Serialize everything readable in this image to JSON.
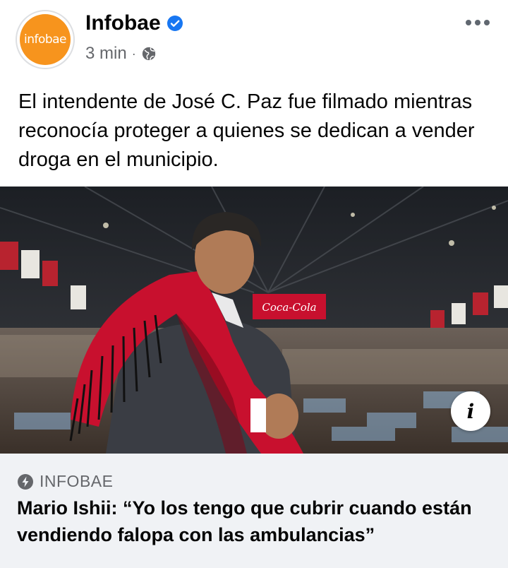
{
  "post": {
    "page_name": "Infobae",
    "avatar_text": "infobae",
    "timestamp": "3 min",
    "separator": "·",
    "audience_icon": "globe-icon",
    "verified_icon": "verified-badge-icon",
    "more_icon": "more-options-icon",
    "text": "El intendente de José C. Paz fue filmado mientras reconocía proteger a quienes se dedican a vender droga en el municipio."
  },
  "image": {
    "info_label": "i",
    "banner_text": "Coca-Cola"
  },
  "link_preview": {
    "source_icon": "lightning-bolt-icon",
    "source": "INFOBAE",
    "title": "Mario Ishii: “Yo los tengo que cubrir cuando están vendiendo falopa con las ambulancias”"
  },
  "colors": {
    "brand_orange": "#f7941d",
    "verified_blue": "#1877f2",
    "secondary_text": "#65676b",
    "preview_bg": "#f0f2f5",
    "poncho_red": "#c8102e"
  }
}
